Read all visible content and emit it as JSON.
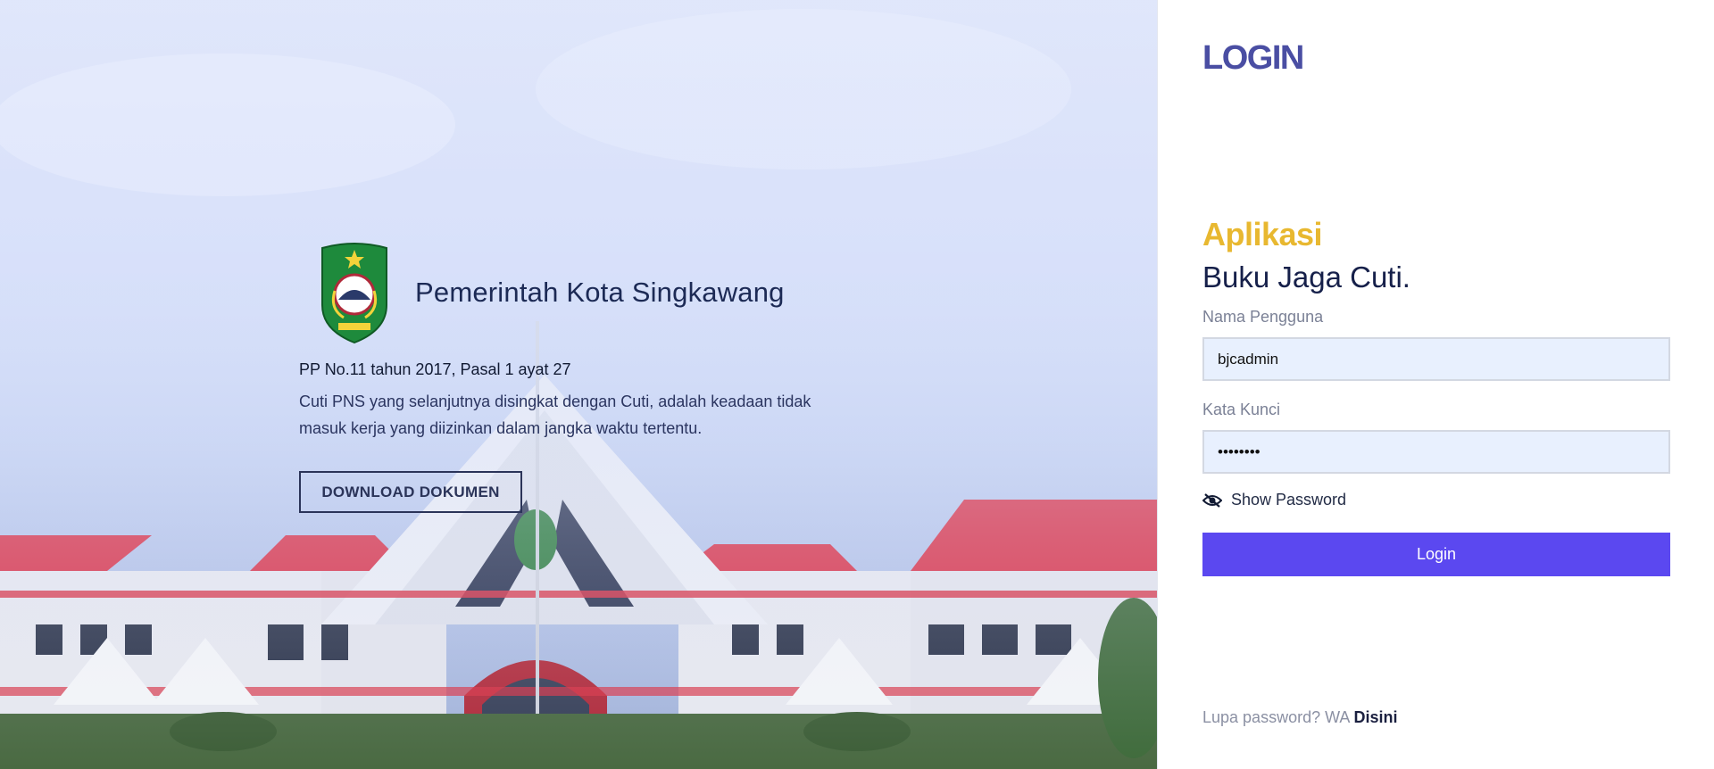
{
  "hero": {
    "brand_title": "Pemerintah Kota Singkawang",
    "regulation_title": "PP No.11 tahun 2017, Pasal 1 ayat 27",
    "regulation_text": "Cuti PNS yang selanjutnya disingkat dengan Cuti, adalah keadaan tidak masuk kerja yang diizinkan dalam jangka waktu tertentu.",
    "download_label": "DOWNLOAD DOKUMEN"
  },
  "login": {
    "heading": "LOGIN",
    "app_eyebrow": "Aplikasi",
    "app_name": "Buku Jaga Cuti.",
    "username_label": "Nama Pengguna",
    "username_value": "bjcadmin",
    "password_label": "Kata Kunci",
    "password_value": "••••••••",
    "show_password_label": "Show Password",
    "submit_label": "Login",
    "forgot_prefix": "Lupa password? WA",
    "forgot_link": "Disini"
  },
  "colors": {
    "accent": "#5b48f0",
    "heading": "#4a4ea3",
    "eyebrow": "#e8b830",
    "input_bg": "#e8f0fe"
  },
  "icons": {
    "logo": "city-emblem-shield",
    "show_password": "eye-slash-icon"
  }
}
